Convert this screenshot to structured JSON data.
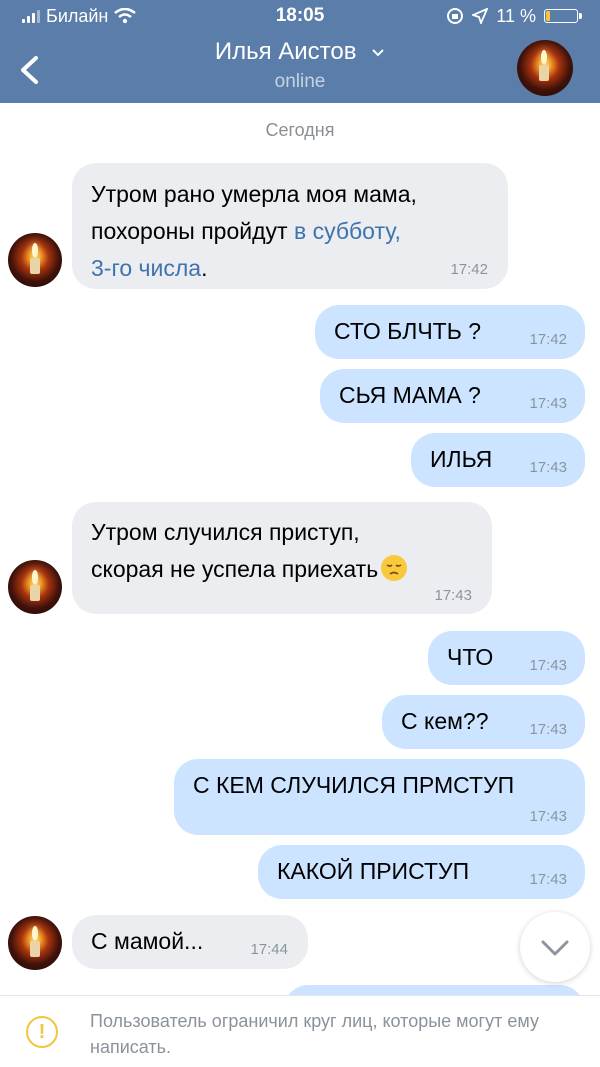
{
  "status_bar": {
    "carrier": "Билайн",
    "time": "18:05",
    "battery": "11 %"
  },
  "header": {
    "name": "Илья Аистов",
    "presence": "online"
  },
  "date_separator": "Сегодня",
  "messages": [
    {
      "dir": "in",
      "line1": "Утром рано умерла моя мама,",
      "line2_a": "похороны пройдут ",
      "link_a": "в субботу,",
      "link_b": "3-го числа",
      "line3_end": ".",
      "time": "17:42"
    },
    {
      "dir": "out",
      "text": "СТО БЛЧТЬ ?",
      "time": "17:42"
    },
    {
      "dir": "out",
      "text": "СЬЯ МАМА ?",
      "time": "17:43"
    },
    {
      "dir": "out",
      "text": "ИЛЬЯ",
      "time": "17:43"
    },
    {
      "dir": "in",
      "line1": "Утром случился приступ,",
      "line2": "скорая не успела приехать",
      "time": "17:43"
    },
    {
      "dir": "out",
      "text": "ЧТО",
      "time": "17:43"
    },
    {
      "dir": "out",
      "text": "С кем??",
      "time": "17:43"
    },
    {
      "dir": "out",
      "text": "С КЕМ СЛУЧИЛСЯ ПРМСТУП",
      "time": "17:43"
    },
    {
      "dir": "out",
      "text": "КАКОЙ ПРИСТУП",
      "time": "17:43"
    },
    {
      "dir": "in",
      "text": "С мамой...",
      "time": "17:44"
    }
  ],
  "footer": {
    "notice": "Пользователь ограничил круг лиц, которые могут ему написать."
  },
  "colors": {
    "header": "#5a7ea9",
    "incoming": "#ebedf0",
    "outgoing": "#cce4ff",
    "link": "#3f73ad"
  }
}
